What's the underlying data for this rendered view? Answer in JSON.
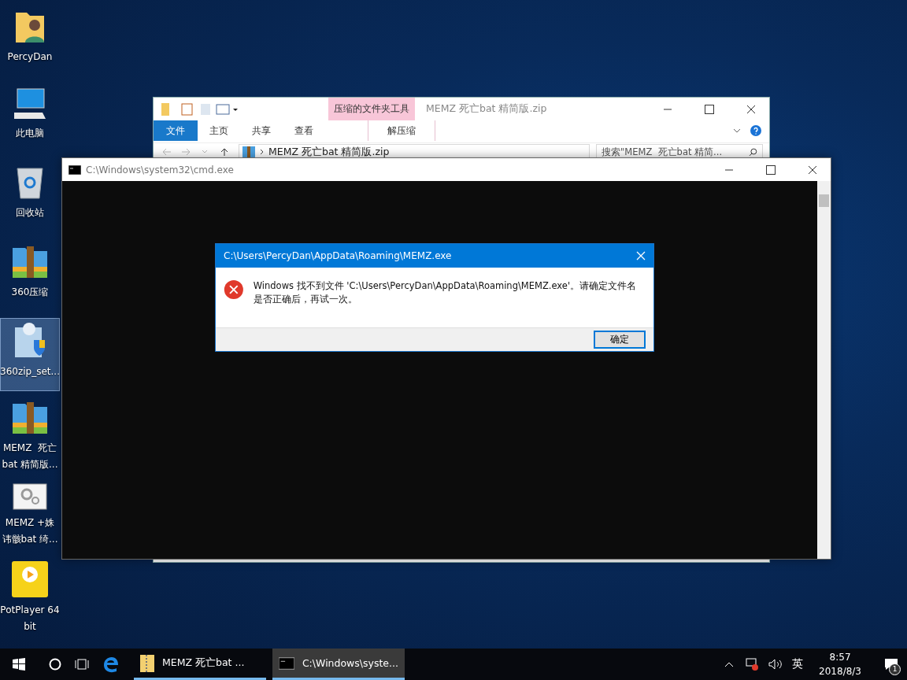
{
  "desktop_icons": [
    {
      "label_lines": [
        "PercyDan"
      ],
      "kind": "user-folder",
      "selected": false
    },
    {
      "label_lines": [
        "此电脑"
      ],
      "kind": "computer",
      "selected": false
    },
    {
      "label_lines": [
        "回收站"
      ],
      "kind": "recycle-bin",
      "selected": false
    },
    {
      "label_lines": [
        "360压缩"
      ],
      "kind": "archiver",
      "selected": false
    },
    {
      "label_lines": [
        "360zip_set..."
      ],
      "kind": "installer",
      "selected": true
    },
    {
      "label_lines": [
        "MEMZ  死亡",
        "bat 精简版..."
      ],
      "kind": "archiver",
      "selected": false
    },
    {
      "label_lines": [
        "MEMZ +姝",
        "讳骸bat 绮..."
      ],
      "kind": "gear-file",
      "selected": false
    },
    {
      "label_lines": [
        "PotPlayer 64",
        "bit"
      ],
      "kind": "player",
      "selected": false
    }
  ],
  "explorer": {
    "title": "MEMZ  死亡bat 精简版.zip",
    "context_group": "压缩的文件夹工具",
    "file_tab": "文件",
    "ribbon_tabs": [
      {
        "label": "主页",
        "selected": false
      },
      {
        "label": "共享",
        "selected": false
      },
      {
        "label": "查看",
        "selected": false
      },
      {
        "label": "解压缩",
        "selected": false
      }
    ],
    "address": "MEMZ  死亡bat 精简版.zip",
    "search": {
      "placeholder": "搜索\"MEMZ  死亡bat 精简..."
    }
  },
  "cmd": {
    "title": "C:\\Windows\\system32\\cmd.exe"
  },
  "dialog": {
    "title": "C:\\Users\\PercyDan\\AppData\\Roaming\\MEMZ.exe",
    "message": "Windows 找不到文件 'C:\\Users\\PercyDan\\AppData\\Roaming\\MEMZ.exe'。请确定文件名是否正确后，再试一次。",
    "button": "确定"
  },
  "taskbar": {
    "apps": [
      {
        "label": "MEMZ  死亡bat ...",
        "kind": "folder",
        "active": false
      },
      {
        "label": "C:\\Windows\\syste...",
        "kind": "console",
        "active": true
      }
    ],
    "ime": "英",
    "time": "8:57",
    "date": "2018/8/3",
    "notifications": "1"
  }
}
